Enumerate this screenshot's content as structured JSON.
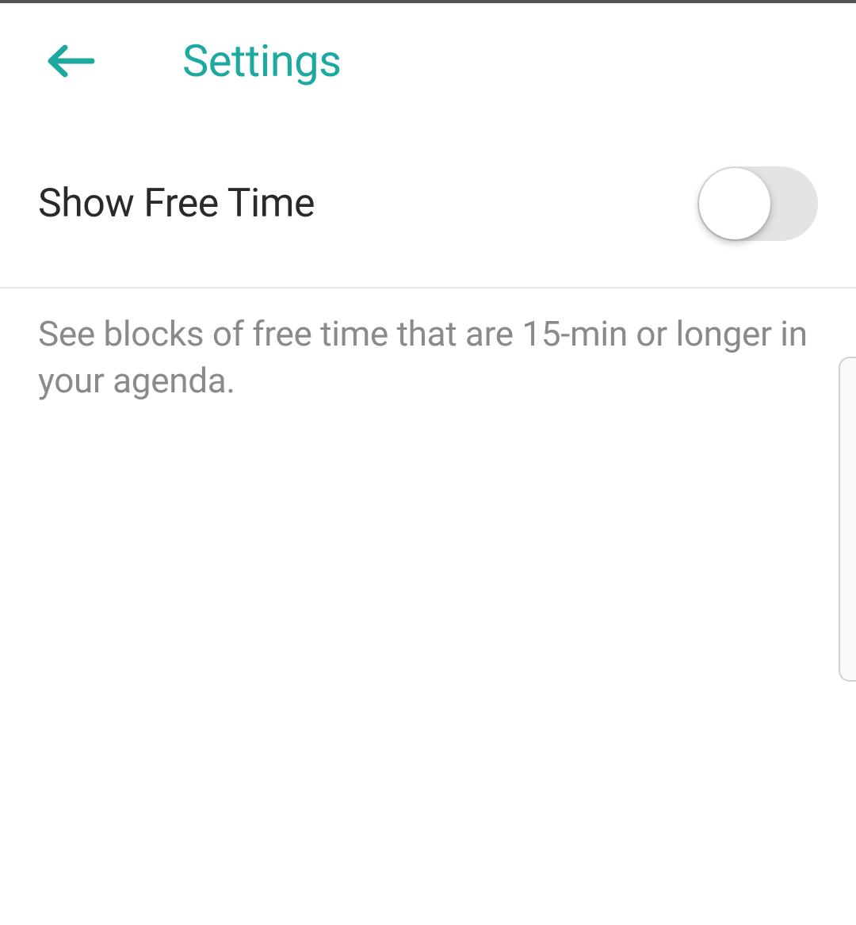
{
  "header": {
    "title": "Settings"
  },
  "settings": {
    "show_free_time": {
      "label": "Show Free Time",
      "enabled": false,
      "description": "See blocks of free time that are 15-min or longer in your agenda."
    }
  },
  "colors": {
    "accent": "#1ba9a0"
  }
}
